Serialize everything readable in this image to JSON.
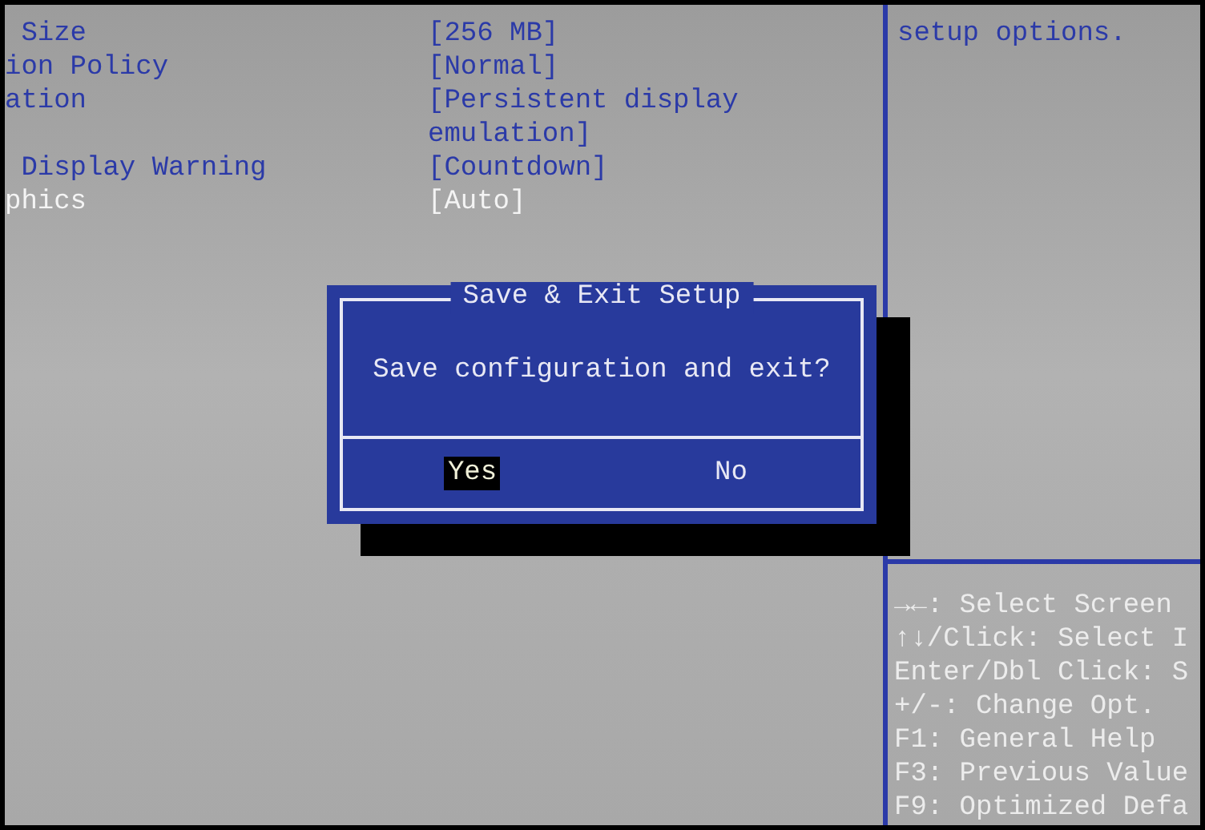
{
  "settings": [
    {
      "label": " Size",
      "value": "[256 MB]",
      "selected": false
    },
    {
      "label": "ion Policy",
      "value": "[Normal]",
      "selected": false
    },
    {
      "label": "ation",
      "value": "[Persistent display emulation]",
      "selected": false
    },
    {
      "label": " Display Warning",
      "value": "[Countdown]",
      "selected": false
    },
    {
      "label": "phics",
      "value": "[Auto]",
      "selected": true
    }
  ],
  "help_text": "setup options.",
  "key_hints": [
    "→←: Select Screen",
    "↑↓/Click: Select I",
    "Enter/Dbl Click: S",
    "+/-: Change Opt.",
    "F1: General Help",
    "F3: Previous Value",
    "F9: Optimized Defa"
  ],
  "dialog": {
    "title": "Save & Exit Setup",
    "message": "Save configuration and exit?",
    "buttons": [
      {
        "label": "Yes",
        "selected": true
      },
      {
        "label": "No",
        "selected": false
      }
    ]
  }
}
